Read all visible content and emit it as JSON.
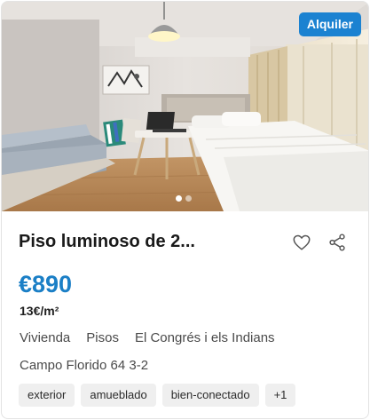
{
  "listing": {
    "badge": "Alquiler",
    "title": "Piso luminoso de 2...",
    "price": "€890",
    "price_per_m2": "13€/m²",
    "meta": [
      "Vivienda",
      "Pisos",
      "El Congrés i els Indians"
    ],
    "address": "Campo Florido 64 3-2",
    "tags": [
      "exterior",
      "amueblado",
      "bien-conectado",
      "+1"
    ],
    "carousel": {
      "count": 2,
      "active": 1
    }
  },
  "icons": {
    "favorite": "heart-icon",
    "share": "share-icon"
  },
  "colors": {
    "accent": "#1b82d1",
    "price": "#1b7fc6",
    "tag_bg": "#efefef"
  }
}
